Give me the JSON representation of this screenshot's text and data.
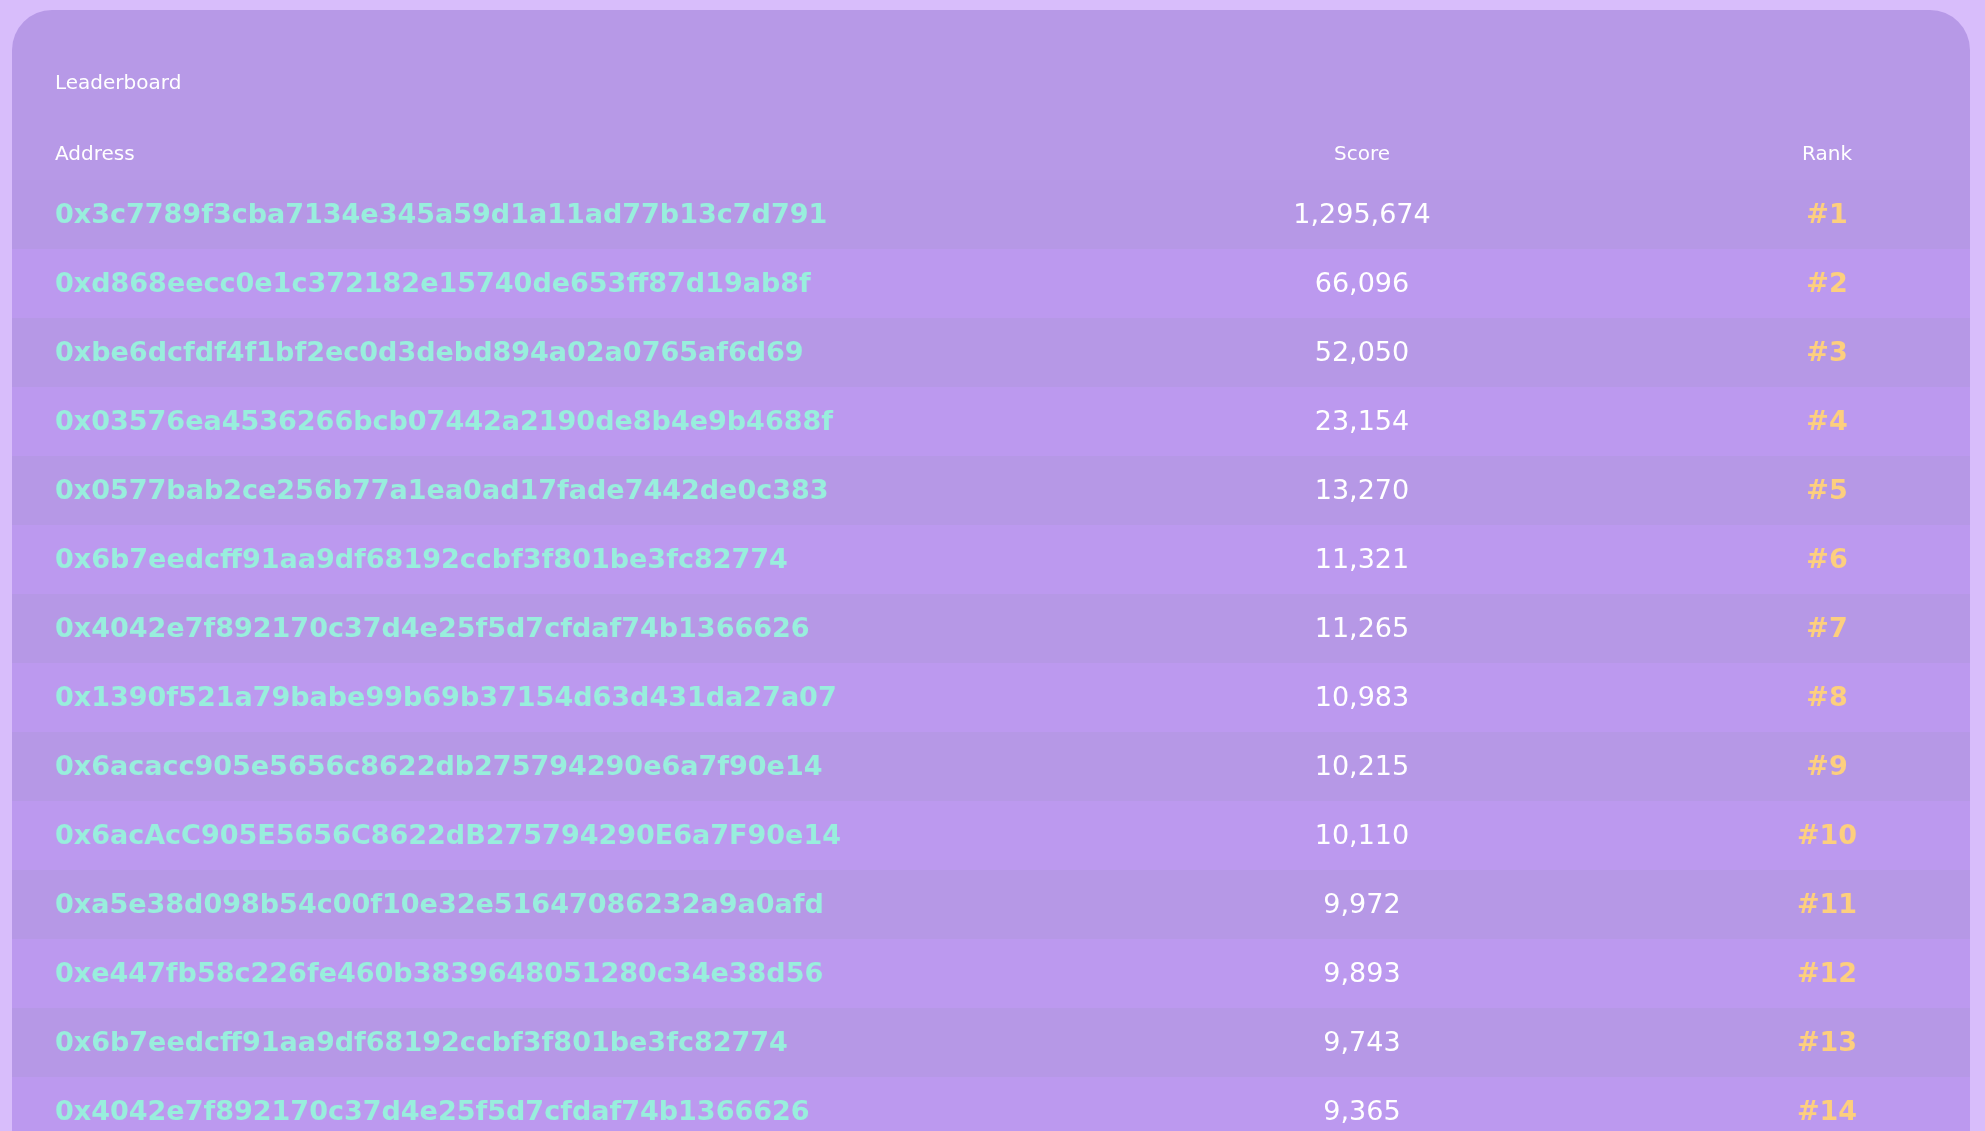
{
  "title": "Leaderboard",
  "columns": [
    "Address",
    "Score",
    "Rank"
  ],
  "rows": [
    {
      "address": "0x3c7789f3cba7134e345a59d1a11ad77b13c7d791",
      "score": "1,295,674",
      "rank": "#1"
    },
    {
      "address": "0xd868eecc0e1c372182e15740de653ff87d19ab8f",
      "score": "66,096",
      "rank": "#2"
    },
    {
      "address": "0xbe6dcfdf4f1bf2ec0d3debd894a02a0765af6d69",
      "score": "52,050",
      "rank": "#3"
    },
    {
      "address": "0x03576ea4536266bcb07442a2190de8b4e9b4688f",
      "score": "23,154",
      "rank": "#4"
    },
    {
      "address": "0x0577bab2ce256b77a1ea0ad17fade7442de0c383",
      "score": "13,270",
      "rank": "#5"
    },
    {
      "address": "0x6b7eedcff91aa9df68192ccbf3f801be3fc82774",
      "score": "11,321",
      "rank": "#6"
    },
    {
      "address": "0x4042e7f892170c37d4e25f5d7cfdaf74b1366626",
      "score": "11,265",
      "rank": "#7"
    },
    {
      "address": "0x1390f521a79babe99b69b37154d63d431da27a07",
      "score": "10,983",
      "rank": "#8"
    },
    {
      "address": "0x6acacc905e5656c8622db275794290e6a7f90e14",
      "score": "10,215",
      "rank": "#9"
    },
    {
      "address": "0x6acAcC905E5656C8622dB275794290E6a7F90e14",
      "score": "10,110",
      "rank": "#10"
    },
    {
      "address": "0xa5e38d098b54c00f10e32e51647086232a9a0afd",
      "score": "9,972",
      "rank": "#11"
    },
    {
      "address": "0xe447fb58c226fe460b3839648051280c34e38d56",
      "score": "9,893",
      "rank": "#12"
    },
    {
      "address": "0x6b7eedcff91aa9df68192ccbf3f801be3fc82774",
      "score": "9,743",
      "rank": "#13"
    },
    {
      "address": "0x4042e7f892170c37d4e25f5d7cfdaf74b1366626",
      "score": "9,365",
      "rank": "#14"
    }
  ]
}
